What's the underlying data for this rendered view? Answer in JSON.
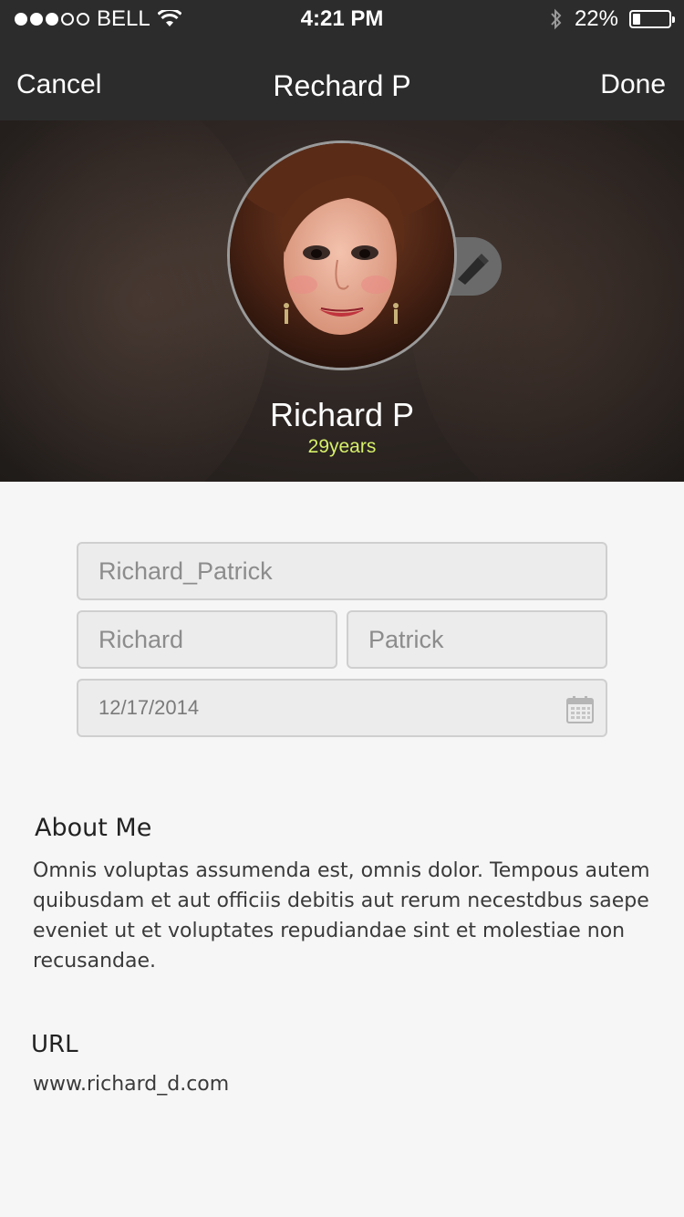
{
  "status_bar": {
    "carrier": "BELL",
    "time": "4:21 PM",
    "battery": "22%",
    "battery_level": 0.22,
    "signal_bars_full": 3,
    "signal_bars_total": 5
  },
  "nav": {
    "cancel_label": "Cancel",
    "title": "Rechard P",
    "done_label": "Done"
  },
  "profile": {
    "name": "Richard P",
    "age": "29years",
    "edit_icon": "pencil-icon"
  },
  "form": {
    "username": "Richard_Patrick",
    "first_name": "Richard",
    "last_name": "Patrick",
    "birthdate": "12/17/2014",
    "date_icon": "calendar-icon"
  },
  "about": {
    "title": "About Me",
    "text": "Omnis voluptas assumenda est, omnis dolor. Tempous autem quibusdam et aut officiis debitis aut rerum necestdbus saepe eveniet ut et voluptates repudiandae sint et molestiae non recusandae."
  },
  "url": {
    "title": "URL",
    "value": "www.richard_d.com"
  },
  "colors": {
    "nav_bg": "#2c2c2c",
    "age_accent": "#d6ef6a",
    "page_bg": "#f6f6f6"
  }
}
